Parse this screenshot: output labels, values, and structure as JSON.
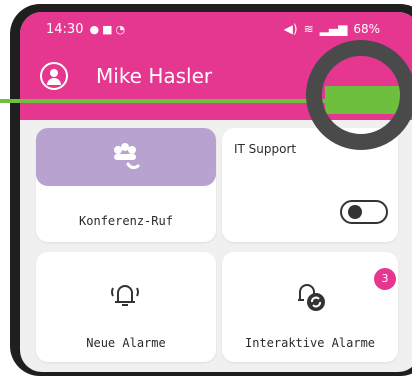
{
  "status_bar": {
    "time": "14:30",
    "right_text": "68%"
  },
  "header": {
    "user_name": "Mike Hasler",
    "color": "#e5378f"
  },
  "cards": [
    {
      "label": "Konferenz-Ruf",
      "icon": "conference-call-icon"
    },
    {
      "title": "IT Support",
      "toggle_state": "off"
    },
    {
      "label": "Neue Alarme",
      "icon": "bell-icon"
    },
    {
      "label": "Interaktive Alarme",
      "icon": "interactive-alarm-icon",
      "badge": "3"
    }
  ],
  "accent_colors": {
    "pink": "#e5378f",
    "purple": "#b8a2cf",
    "green": "#6fbf3f"
  }
}
